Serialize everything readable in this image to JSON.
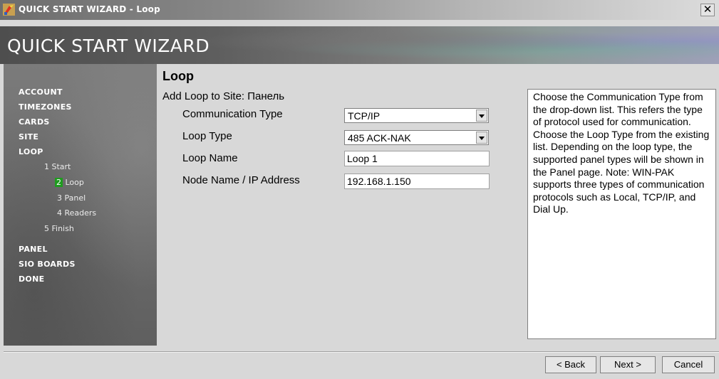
{
  "window": {
    "title": "QUICK START WIZARD - Loop",
    "app_icon": "wizard-app-icon",
    "close_glyph": "✕"
  },
  "banner": {
    "title": "QUICK START WIZARD"
  },
  "sidebar": {
    "items": [
      {
        "label": "ACCOUNT"
      },
      {
        "label": "TIMEZONES"
      },
      {
        "label": "CARDS"
      },
      {
        "label": "SITE"
      },
      {
        "label": "LOOP"
      }
    ],
    "loop_steps": [
      {
        "num": "1",
        "label": "Start"
      },
      {
        "num": "2",
        "label": "Loop",
        "active": true
      },
      {
        "num": "3",
        "label": "Panel"
      },
      {
        "num": "4",
        "label": "Readers"
      },
      {
        "num": "5",
        "label": "Finish"
      }
    ],
    "items_after": [
      {
        "label": "PANEL"
      },
      {
        "label": "SIO BOARDS"
      },
      {
        "label": "DONE"
      }
    ]
  },
  "main": {
    "title": "Loop",
    "subtitle": "Add Loop to Site: Панель",
    "fields": {
      "communication_type": {
        "label": "Communication Type",
        "value": "TCP/IP"
      },
      "loop_type": {
        "label": "Loop Type",
        "value": "485 ACK-NAK"
      },
      "loop_name": {
        "label": "Loop Name",
        "value": "Loop 1"
      },
      "node_name": {
        "label": "Node Name / IP Address",
        "value": "192.168.1.150"
      }
    }
  },
  "help": {
    "text": "Choose the Communication Type from the drop-down list. This refers the type of protocol used for communication. Choose the Loop Type from the existing list. Depending on the loop type, the supported panel types will be shown in the Panel page. Note: WIN-PAK supports three types of communication protocols such as Local, TCP/IP, and Dial Up."
  },
  "footer": {
    "back_label": "< Back",
    "next_label": "Next >",
    "cancel_label": "Cancel"
  },
  "colors": {
    "active_step": "#1f9b1f",
    "sidebar_text": "#ffffff",
    "window_bg": "#d8d8d8"
  }
}
